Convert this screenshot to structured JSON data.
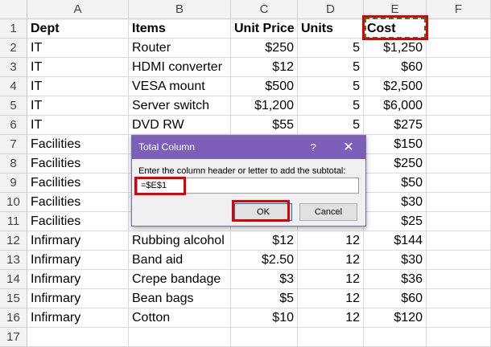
{
  "columns": [
    "A",
    "B",
    "C",
    "D",
    "E",
    "F"
  ],
  "header_row": {
    "dept": "Dept",
    "items": "Items",
    "unit_price": "Unit Price",
    "units": "Units",
    "cost": "Cost"
  },
  "rows": [
    {
      "num": "2",
      "dept": "IT",
      "item": "Router",
      "price": "$250",
      "units": "5",
      "cost": "$1,250"
    },
    {
      "num": "3",
      "dept": "IT",
      "item": "HDMI converter",
      "price": "$12",
      "units": "5",
      "cost": "$60"
    },
    {
      "num": "4",
      "dept": "IT",
      "item": "VESA mount",
      "price": "$500",
      "units": "5",
      "cost": "$2,500"
    },
    {
      "num": "5",
      "dept": "IT",
      "item": "Server switch",
      "price": "$1,200",
      "units": "5",
      "cost": "$6,000"
    },
    {
      "num": "6",
      "dept": "IT",
      "item": "DVD RW",
      "price": "$55",
      "units": "5",
      "cost": "$275"
    },
    {
      "num": "7",
      "dept": "Facilities",
      "item": "",
      "price": "",
      "units": "",
      "cost": "$150"
    },
    {
      "num": "8",
      "dept": "Facilities",
      "item": "",
      "price": "",
      "units": "",
      "cost": "$250"
    },
    {
      "num": "9",
      "dept": "Facilities",
      "item": "",
      "price": "",
      "units": "",
      "cost": "$50"
    },
    {
      "num": "10",
      "dept": "Facilities",
      "item": "",
      "price": "",
      "units": "",
      "cost": "$30"
    },
    {
      "num": "11",
      "dept": "Facilities",
      "item": "",
      "price": "",
      "units": "",
      "cost": "$25"
    },
    {
      "num": "12",
      "dept": "Infirmary",
      "item": "Rubbing alcohol",
      "price": "$12",
      "units": "12",
      "cost": "$144"
    },
    {
      "num": "13",
      "dept": "Infirmary",
      "item": "Band aid",
      "price": "$2.50",
      "units": "12",
      "cost": "$30"
    },
    {
      "num": "14",
      "dept": "Infirmary",
      "item": "Crepe bandage",
      "price": "$3",
      "units": "12",
      "cost": "$36"
    },
    {
      "num": "15",
      "dept": "Infirmary",
      "item": "Bean bags",
      "price": "$5",
      "units": "12",
      "cost": "$60"
    },
    {
      "num": "16",
      "dept": "Infirmary",
      "item": "Cotton",
      "price": "$10",
      "units": "12",
      "cost": "$120"
    }
  ],
  "row1_num": "1",
  "row17_num": "17",
  "dialog": {
    "title": "Total Column",
    "help": "?",
    "close": "✕",
    "prompt": "Enter the column header or letter to add the subtotal:",
    "input_value": "=$E$1",
    "ok_label": "OK",
    "cancel_label": "Cancel"
  },
  "colors": {
    "titlebar": "#7b5fb8",
    "highlight": "#e00000",
    "copy_marquee": "#2e7d32"
  }
}
